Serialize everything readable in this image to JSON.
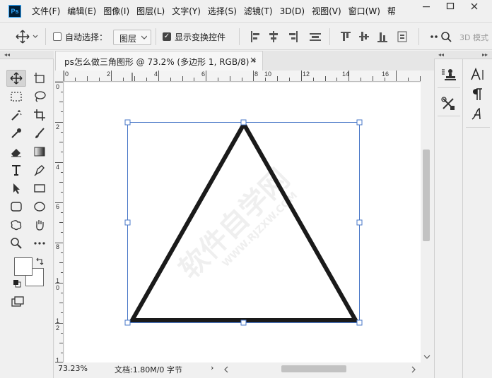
{
  "app": {
    "logo": "Ps",
    "menus": [
      "文件(F)",
      "编辑(E)",
      "图像(I)",
      "图层(L)",
      "文字(Y)",
      "选择(S)",
      "滤镜(T)",
      "3D(D)",
      "视图(V)",
      "窗口(W)",
      "帮"
    ]
  },
  "options": {
    "auto_select_label": "自动选择：",
    "layer_select_value": "图层",
    "show_transform_label": "显示变换控件",
    "mode_3d_label": "3D 模式"
  },
  "document": {
    "tab_title": "ps怎么做三角图形 @ 73.2% (多边形 1, RGB/8) *",
    "close_glyph": "×",
    "ruler_top_labels": [
      "0",
      "2",
      "4",
      "6",
      "8",
      "10",
      "12",
      "14",
      "16"
    ],
    "ruler_left_labels": [
      "0",
      "2",
      "4",
      "6",
      "8",
      "1\n0",
      "1\n2",
      "1"
    ],
    "watermark": "软件自学网",
    "watermark_url": "WWW.RJZXW.COM"
  },
  "status": {
    "zoom": "73.23%",
    "doc_info": "文档:1.80M/0 字节",
    "arrow": "›"
  },
  "panels": {
    "collapse_left": "◂◂",
    "collapse_right": "▸▸"
  }
}
